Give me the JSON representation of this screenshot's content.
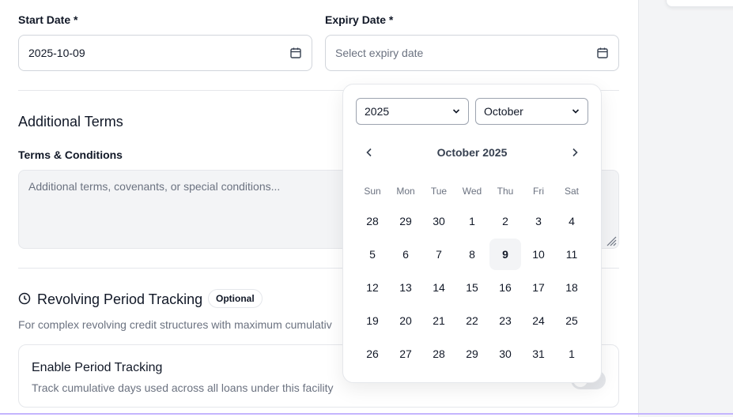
{
  "dates": {
    "start_label": "Start Date *",
    "start_value": "2025-10-09",
    "expiry_label": "Expiry Date *",
    "expiry_placeholder": "Select expiry date"
  },
  "additional_terms": {
    "title": "Additional Terms",
    "terms_label": "Terms & Conditions",
    "terms_placeholder": "Additional terms, covenants, or special conditions..."
  },
  "revolving": {
    "title": "Revolving Period Tracking",
    "badge": "Optional",
    "description": "For complex revolving credit structures with maximum cumulativ",
    "card_title": "Enable Period Tracking",
    "card_subtitle": "Track cumulative days used across all loans under this facility",
    "toggle_on": false
  },
  "calendar": {
    "year_select": "2025",
    "month_select": "October",
    "month_label": "October 2025",
    "weekdays": [
      "Sun",
      "Mon",
      "Tue",
      "Wed",
      "Thu",
      "Fri",
      "Sat"
    ],
    "weeks": [
      [
        "28",
        "29",
        "30",
        "1",
        "2",
        "3",
        "4"
      ],
      [
        "5",
        "6",
        "7",
        "8",
        "9",
        "10",
        "11"
      ],
      [
        "12",
        "13",
        "14",
        "15",
        "16",
        "17",
        "18"
      ],
      [
        "19",
        "20",
        "21",
        "22",
        "23",
        "24",
        "25"
      ],
      [
        "26",
        "27",
        "28",
        "29",
        "30",
        "31",
        "1"
      ]
    ],
    "selected_day": "9"
  },
  "colors": {
    "accent_bottom_line": "#c4b5fd",
    "selected_day_bg": "#f3f4f6"
  }
}
